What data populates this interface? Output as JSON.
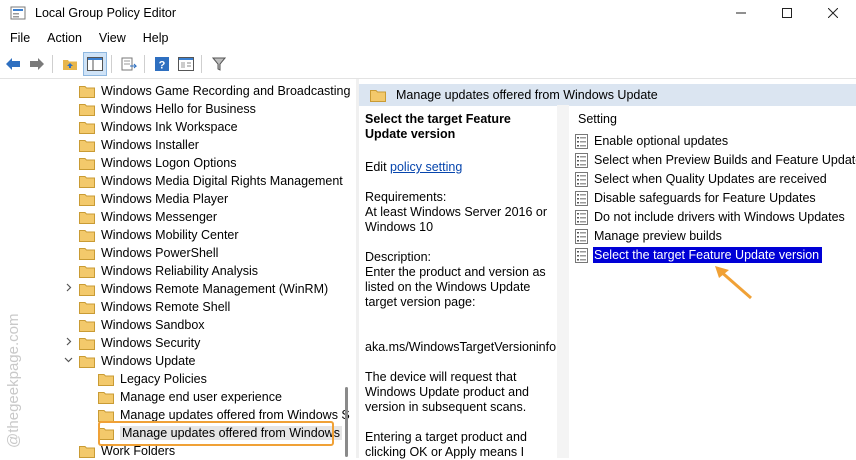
{
  "window": {
    "title": "Local Group Policy Editor"
  },
  "menu": [
    "File",
    "Action",
    "View",
    "Help"
  ],
  "tree": {
    "items": [
      {
        "label": "Windows Game Recording and Broadcasting",
        "indent": 0
      },
      {
        "label": "Windows Hello for Business",
        "indent": 0
      },
      {
        "label": "Windows Ink Workspace",
        "indent": 0
      },
      {
        "label": "Windows Installer",
        "indent": 0
      },
      {
        "label": "Windows Logon Options",
        "indent": 0
      },
      {
        "label": "Windows Media Digital Rights Management",
        "indent": 0
      },
      {
        "label": "Windows Media Player",
        "indent": 0
      },
      {
        "label": "Windows Messenger",
        "indent": 0
      },
      {
        "label": "Windows Mobility Center",
        "indent": 0
      },
      {
        "label": "Windows PowerShell",
        "indent": 0
      },
      {
        "label": "Windows Reliability Analysis",
        "indent": 0
      },
      {
        "label": "Windows Remote Management (WinRM)",
        "indent": 0,
        "expander": ">"
      },
      {
        "label": "Windows Remote Shell",
        "indent": 0
      },
      {
        "label": "Windows Sandbox",
        "indent": 0
      },
      {
        "label": "Windows Security",
        "indent": 0,
        "expander": ">"
      },
      {
        "label": "Windows Update",
        "indent": 0,
        "expander": "v"
      },
      {
        "label": "Legacy Policies",
        "indent": 1
      },
      {
        "label": "Manage end user experience",
        "indent": 1
      },
      {
        "label": "Manage updates offered from Windows S",
        "indent": 1
      },
      {
        "label": "Manage updates offered from Windows",
        "indent": 1,
        "selected": true
      },
      {
        "label": "Work Folders",
        "indent": 0
      }
    ]
  },
  "right": {
    "header": "Manage updates offered from Windows Update",
    "desc": {
      "title": "Select the target Feature Update version",
      "edit_prefix": "Edit ",
      "edit_link": "policy setting",
      "requirements_label": "Requirements:",
      "requirements": "At least Windows Server 2016 or Windows 10",
      "description_label": "Description:",
      "description": "Enter the product and version as listed on the Windows Update target version page:",
      "url": "aka.ms/WindowsTargetVersioninfo",
      "p2": "The device will request that Windows Update product and version in subsequent scans.",
      "p3": "Entering a target product and clicking OK or Apply means I"
    },
    "settings_header": "Setting",
    "settings": [
      "Enable optional updates",
      "Select when Preview Builds and Feature Updates a",
      "Select when Quality Updates are received",
      "Disable safeguards for Feature Updates",
      "Do not include drivers with Windows Updates",
      "Manage preview builds",
      "Select the target Feature Update version"
    ],
    "selected_index": 6
  },
  "watermark": "@thegeekpage.com",
  "colors": {
    "selection": "#0000d6",
    "header_band": "#dbe5f1",
    "annotation": "#f0a136"
  }
}
